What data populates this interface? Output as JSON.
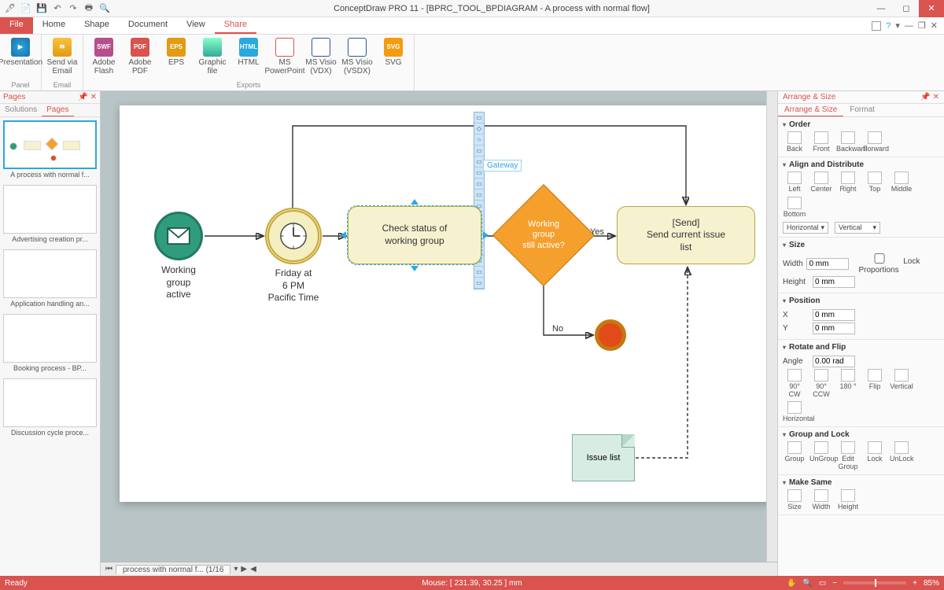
{
  "window": {
    "title": "ConceptDraw PRO 11 - [BPRC_TOOL_BPDIAGRAM - A process with normal flow]"
  },
  "ribbon": {
    "tabs": {
      "file": "File",
      "home": "Home",
      "shape": "Shape",
      "document": "Document",
      "view": "View",
      "share": "Share"
    },
    "groups": {
      "panel": "Panel",
      "email": "Email",
      "exports": "Exports"
    },
    "buttons": {
      "presentation": "Presentation",
      "send_email": "Send via\nEmail",
      "adobe_flash": "Adobe\nFlash",
      "adobe_pdf": "Adobe\nPDF",
      "eps": "EPS",
      "graphic_file": "Graphic\nfile",
      "html": "HTML",
      "ms_ppt": "MS\nPowerPoint",
      "ms_visio_vdx": "MS Visio\n(VDX)",
      "ms_visio_vsdx": "MS Visio\n(VSDX)",
      "svg": "SVG"
    }
  },
  "pages_panel": {
    "title": "Pages",
    "subtabs": {
      "solutions": "Solutions",
      "pages": "Pages"
    },
    "thumbs": [
      "A process with normal f...",
      "Advertising creation pr...",
      "Application handling an...",
      "Booking  process - BP...",
      "Discussion cycle proce..."
    ]
  },
  "diagram": {
    "start_label": "Working\ngroup\nactive",
    "timer_label": "Friday at\n6 PM\nPacific Time",
    "task_label": "Check status of\nworking group",
    "gateway_label": "Working\ngroup\nstill active?",
    "send_label": "[Send]\nSend current issue\nlist",
    "yes": "Yes",
    "no": "No",
    "doc_label": "Issue list",
    "tooltip": "Gateway"
  },
  "doc_tab": "process with normal f... (1/16",
  "arrange": {
    "title": "Arrange & Size",
    "subtabs": {
      "arrange": "Arrange & Size",
      "format": "Format"
    },
    "sections": {
      "order": "Order",
      "align": "Align and Distribute",
      "size": "Size",
      "position": "Position",
      "rotate": "Rotate and Flip",
      "group": "Group and Lock",
      "same": "Make Same"
    },
    "tools": {
      "back": "Back",
      "front": "Front",
      "backward": "Backward",
      "forward": "Forward",
      "left": "Left",
      "center": "Center",
      "right": "Right",
      "top": "Top",
      "middle": "Middle",
      "bottom": "Bottom",
      "horizontal": "Horizontal",
      "vertical": "Vertical",
      "width": "Width",
      "height": "Height",
      "lockprop": "Lock Proportions",
      "x": "X",
      "y": "Y",
      "angle": "Angle",
      "cw": "90° CW",
      "ccw": "90° CCW",
      "r180": "180 °",
      "flip": "Flip",
      "fv": "Vertical",
      "fh": "Horizontal",
      "group": "Group",
      "ungroup": "UnGroup",
      "editgroup": "Edit\nGroup",
      "lock": "Lock",
      "unlock": "UnLock",
      "ssize": "Size",
      "swidth": "Width",
      "sheight": "Height"
    },
    "values": {
      "width": "0 mm",
      "height": "0 mm",
      "x": "0 mm",
      "y": "0 mm",
      "angle": "0.00 rad"
    }
  },
  "status": {
    "ready": "Ready",
    "mouse": "Mouse: [ 231.39, 30.25 ] mm",
    "zoom": "85%"
  }
}
